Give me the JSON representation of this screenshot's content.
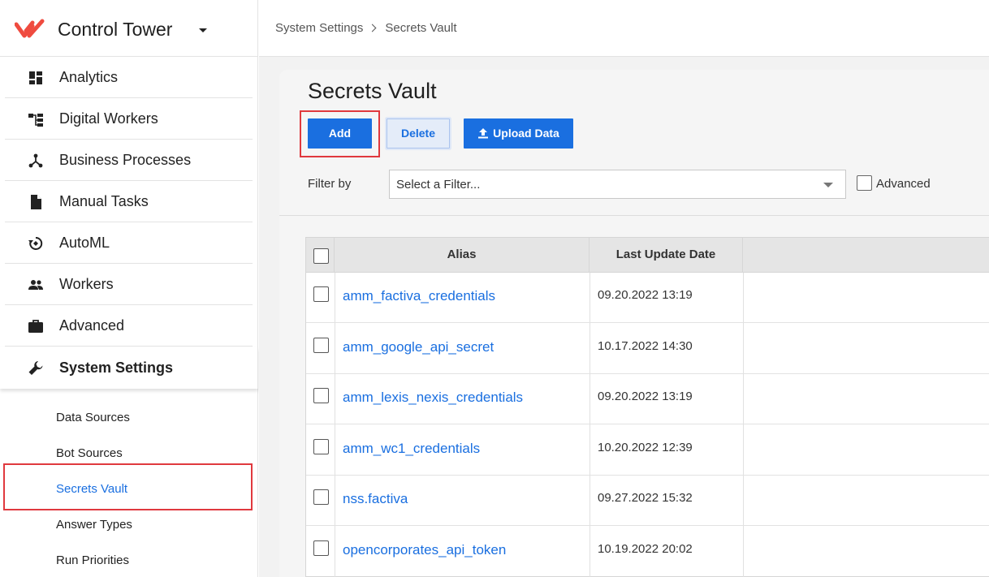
{
  "app": {
    "title": "Control Tower",
    "brand_color": "#ef4b3f",
    "accent_color": "#1a6fe0"
  },
  "sidebar": {
    "items": [
      {
        "label": "Analytics",
        "icon": "dashboard-icon"
      },
      {
        "label": "Digital Workers",
        "icon": "hierarchy-icon"
      },
      {
        "label": "Business Processes",
        "icon": "process-flow-icon"
      },
      {
        "label": "Manual Tasks",
        "icon": "document-icon"
      },
      {
        "label": "AutoML",
        "icon": "automl-icon"
      },
      {
        "label": "Workers",
        "icon": "people-icon"
      },
      {
        "label": "Advanced",
        "icon": "briefcase-icon"
      },
      {
        "label": "System Settings",
        "icon": "wrench-icon",
        "active": true
      }
    ],
    "sub_items": [
      {
        "label": "Data Sources"
      },
      {
        "label": "Bot Sources"
      },
      {
        "label": "Secrets Vault",
        "selected": true
      },
      {
        "label": "Answer Types"
      },
      {
        "label": "Run Priorities"
      }
    ]
  },
  "breadcrumb": {
    "parent": "System Settings",
    "current": "Secrets Vault"
  },
  "page": {
    "title": "Secrets Vault",
    "buttons": {
      "add": "Add",
      "delete": "Delete",
      "upload": "Upload Data"
    },
    "filter": {
      "label": "Filter by",
      "placeholder": "Select a Filter...",
      "advanced_label": "Advanced"
    }
  },
  "table": {
    "columns": [
      "Alias",
      "Last Update Date"
    ],
    "rows": [
      {
        "alias": "amm_factiva_credentials",
        "date": "09.20.2022 13:19"
      },
      {
        "alias": "amm_google_api_secret",
        "date": "10.17.2022 14:30"
      },
      {
        "alias": "amm_lexis_nexis_credentials",
        "date": "09.20.2022 13:19"
      },
      {
        "alias": "amm_wc1_credentials",
        "date": "10.20.2022 12:39"
      },
      {
        "alias": "nss.factiva",
        "date": "09.27.2022 15:32"
      },
      {
        "alias": "opencorporates_api_token",
        "date": "10.19.2022 20:02"
      }
    ]
  }
}
